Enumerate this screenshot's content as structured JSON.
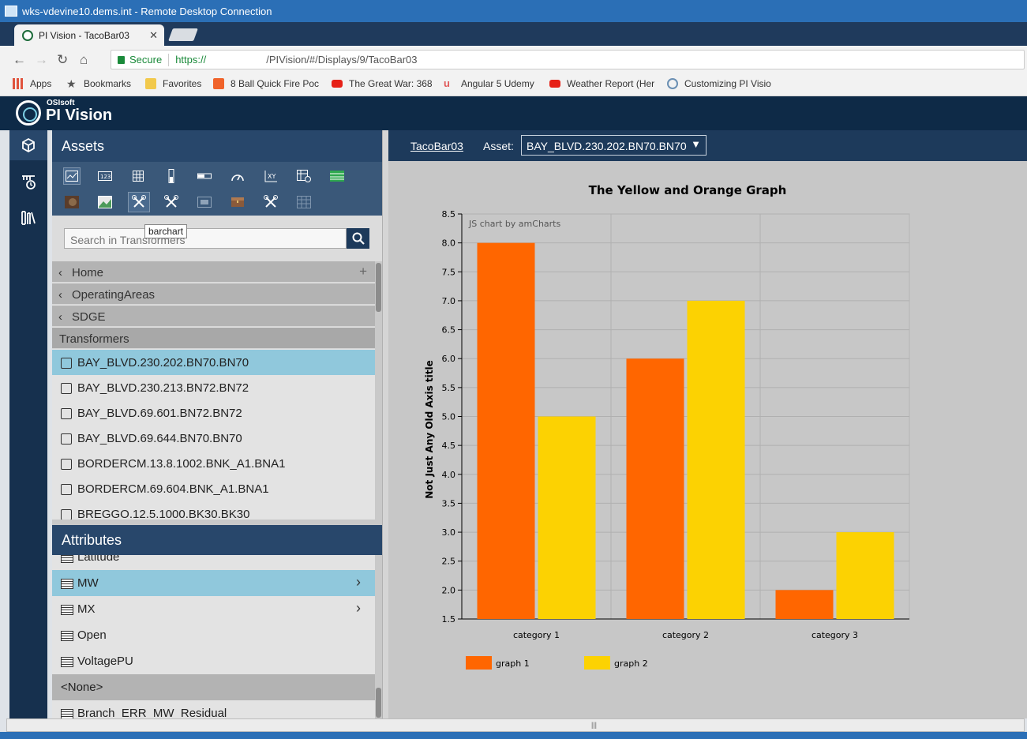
{
  "window": {
    "rdp_title": "wks-vdevine10.dems.int - Remote Desktop Connection"
  },
  "browser": {
    "tab_title": "PI Vision - TacoBar03",
    "secure_label": "Secure",
    "url_proto": "https://",
    "url_path": "/PIVision/#/Displays/9/TacoBar03",
    "bookmarks": [
      {
        "label": "Apps",
        "icon": "apps-grid-icon",
        "color": "#e0533d"
      },
      {
        "label": "Bookmarks",
        "icon": "star-icon",
        "color": "#555555"
      },
      {
        "label": "Favorites",
        "icon": "folder-icon",
        "color": "#f2c94c"
      },
      {
        "label": "8 Ball Quick Fire Poc",
        "icon": "m-logo-icon",
        "color": "#f0632a"
      },
      {
        "label": "The Great War: 368",
        "icon": "youtube-icon",
        "color": "#e62117"
      },
      {
        "label": "Angular 5 Udemy",
        "icon": "udemy-icon",
        "color": "#e05a5a"
      },
      {
        "label": "Weather Report (Her",
        "icon": "youtube-icon",
        "color": "#e62117"
      },
      {
        "label": "Customizing PI Visio",
        "icon": "pi-logo-icon",
        "color": "#6a8fb3"
      }
    ]
  },
  "app": {
    "brand_small": "OSIsoft",
    "brand": "PI Vision",
    "assets_title": "Assets",
    "tooltip": "barchart",
    "search_placeholder": "Search in Transformers",
    "breadcrumbs": [
      "Home",
      "OperatingAreas",
      "SDGE"
    ],
    "current_level": "Transformers",
    "assets": [
      "BAY_BLVD.230.202.BN70.BN70",
      "BAY_BLVD.230.213.BN72.BN72",
      "BAY_BLVD.69.601.BN72.BN72",
      "BAY_BLVD.69.644.BN70.BN70",
      "BORDERCM.13.8.1002.BNK_A1.BNA1",
      "BORDERCM.69.604.BNK_A1.BNA1",
      "BREGGO.12.5.1000.BK30.BK30"
    ],
    "attributes_title": "Attributes",
    "attributes": [
      "Latitude",
      "MW",
      "MX",
      "Open",
      "VoltagePU"
    ],
    "none_group": "<None>",
    "none_items": [
      "Branch_ERR_MW_Residual"
    ]
  },
  "display": {
    "name": "TacoBar03",
    "asset_label": "Asset:",
    "asset_value": "BAY_BLVD.230.202.BN70.BN70"
  },
  "chart_data": {
    "type": "bar",
    "title": "The Yellow and Orange Graph",
    "watermark": "JS chart by amCharts",
    "xlabel": "",
    "ylabel": "Not Just Any Old Axis title",
    "ylim": [
      1.5,
      8.5
    ],
    "yticks": [
      "1.5",
      "2.0",
      "2.5",
      "3.0",
      "3.5",
      "4.0",
      "4.5",
      "5.0",
      "5.5",
      "6.0",
      "6.5",
      "7.0",
      "7.5",
      "8.0",
      "8.5"
    ],
    "categories": [
      "category 1",
      "category 2",
      "category 3"
    ],
    "series": [
      {
        "name": "graph 1",
        "values": [
          8,
          6,
          2
        ],
        "color": "#ff6600"
      },
      {
        "name": "graph 2",
        "values": [
          5,
          7,
          3
        ],
        "color": "#fcd202"
      }
    ],
    "legend_position": "bottom-left",
    "grid": true
  }
}
